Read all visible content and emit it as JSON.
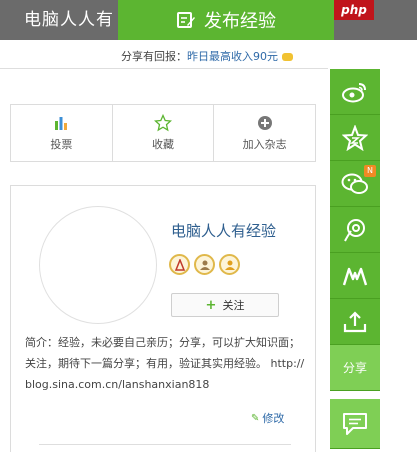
{
  "header": {
    "brand": "电脑人人有",
    "publish_label": "发布经验",
    "badge": "php"
  },
  "promo": {
    "prefix": "分享有回报：",
    "highlight": "昨日最高收入90元"
  },
  "actions": [
    {
      "label": "投票",
      "icon": "bar-chart-icon"
    },
    {
      "label": "收藏",
      "icon": "star-icon"
    },
    {
      "label": "加入杂志",
      "icon": "plus-circle-icon"
    }
  ],
  "profile": {
    "name": "电脑人人有经验",
    "follow_label": "关注",
    "intro": "简介：经验，未必要自己亲历；分享，可以扩大知识面；关注，期待下一篇分享；有用，验证其实用经验。 http://blog.sina.com.cn/lanshanxian818",
    "edit_label": "修改"
  },
  "share_rail": {
    "items": [
      "weibo-icon",
      "qzone-star-icon",
      "wechat-icon",
      "renren-icon",
      "kaixin-icon",
      "upload-icon"
    ],
    "wechat_badge": "N",
    "share_label": "分享",
    "message_icon": "chat-bubble-icon"
  },
  "colors": {
    "green": "#5cb531",
    "light_green": "#7fcf55",
    "topbar_gray": "#6b6b6b",
    "link_blue": "#2f6aa8",
    "php_red": "#c0141b"
  }
}
